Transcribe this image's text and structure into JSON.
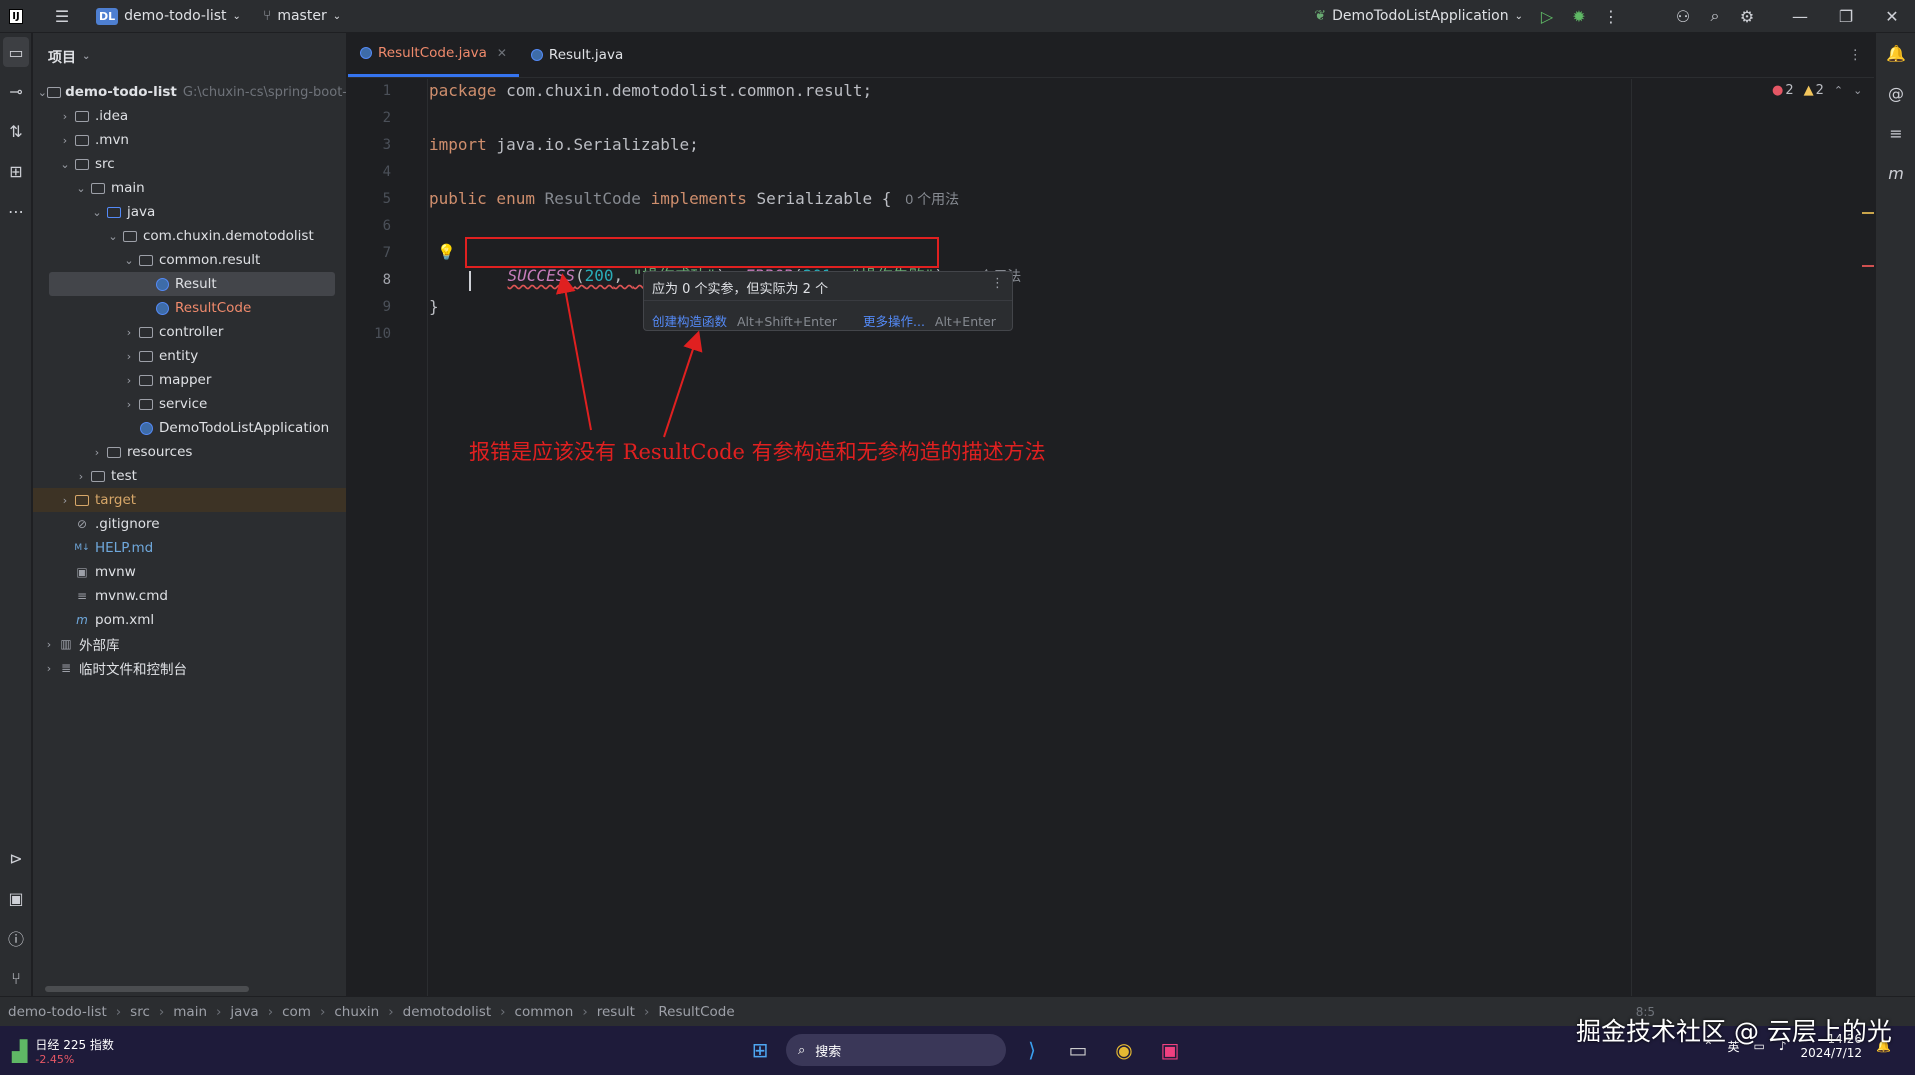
{
  "titlebar": {
    "project_badge": "DL",
    "project_name": "demo-todo-list",
    "branch": "master",
    "run_config": "DemoTodoListApplication"
  },
  "project_panel": {
    "title": "项目",
    "tree": [
      {
        "label": "demo-todo-list",
        "extra": "G:\\chuxin-cs\\spring-boot-",
        "indent": 0,
        "chev": "v",
        "icon": "folder",
        "bold": true
      },
      {
        "label": ".idea",
        "indent": 1,
        "chev": ">",
        "icon": "folder"
      },
      {
        "label": ".mvn",
        "indent": 1,
        "chev": ">",
        "icon": "folder"
      },
      {
        "label": "src",
        "indent": 1,
        "chev": "v",
        "icon": "folder"
      },
      {
        "label": "main",
        "indent": 2,
        "chev": "v",
        "icon": "folder"
      },
      {
        "label": "java",
        "indent": 3,
        "chev": "v",
        "icon": "folder-blue"
      },
      {
        "label": "com.chuxin.demotodolist",
        "indent": 4,
        "chev": "v",
        "icon": "folder"
      },
      {
        "label": "common.result",
        "indent": 5,
        "chev": "v",
        "icon": "folder"
      },
      {
        "label": "Result",
        "indent": 6,
        "chev": "",
        "icon": "class",
        "selected": true
      },
      {
        "label": "ResultCode",
        "indent": 6,
        "chev": "",
        "icon": "class",
        "color": "#f08a6c"
      },
      {
        "label": "controller",
        "indent": 5,
        "chev": ">",
        "icon": "folder"
      },
      {
        "label": "entity",
        "indent": 5,
        "chev": ">",
        "icon": "folder"
      },
      {
        "label": "mapper",
        "indent": 5,
        "chev": ">",
        "icon": "folder"
      },
      {
        "label": "service",
        "indent": 5,
        "chev": ">",
        "icon": "folder"
      },
      {
        "label": "DemoTodoListApplication",
        "indent": 5,
        "chev": "",
        "icon": "class"
      },
      {
        "label": "resources",
        "indent": 3,
        "chev": ">",
        "icon": "folder"
      },
      {
        "label": "test",
        "indent": 2,
        "chev": ">",
        "icon": "folder"
      },
      {
        "label": "target",
        "indent": 1,
        "chev": ">",
        "icon": "folder-orange",
        "target": true,
        "color": "#d7a769"
      },
      {
        "label": ".gitignore",
        "indent": 1,
        "chev": "",
        "icon": "ignore"
      },
      {
        "label": "HELP.md",
        "indent": 1,
        "chev": "",
        "icon": "md",
        "color": "#6fa8dc"
      },
      {
        "label": "mvnw",
        "indent": 1,
        "chev": "",
        "icon": "term"
      },
      {
        "label": "mvnw.cmd",
        "indent": 1,
        "chev": "",
        "icon": "text"
      },
      {
        "label": "pom.xml",
        "indent": 1,
        "chev": "",
        "icon": "maven"
      },
      {
        "label": "外部库",
        "indent": 0,
        "chev": ">",
        "icon": "lib"
      },
      {
        "label": "临时文件和控制台",
        "indent": 0,
        "chev": ">",
        "icon": "scratch"
      }
    ]
  },
  "tabs": [
    {
      "label": "ResultCode.java",
      "active": true
    },
    {
      "label": "Result.java",
      "active": false
    }
  ],
  "editor": {
    "line_numbers": [
      "1",
      "2",
      "3",
      "4",
      "5",
      "6",
      "7",
      "8",
      "9",
      "10"
    ],
    "line1": {
      "kw": "package",
      "rest": " com.chuxin.demotodolist.common.result;"
    },
    "line3": {
      "kw": "import",
      "rest": " java.io.Serializable;"
    },
    "line5": {
      "kw1": "public enum",
      "name": " ResultCode",
      "kw2": " implements",
      "rest": " Serializable {",
      "hint": "0 个用法"
    },
    "line7": {
      "c1": "SUCCESS",
      "p1": "(",
      "n1": "200",
      "s1": "\"操作成功\"",
      "c2": "ERROR",
      "n2": "201",
      "s2": "\"操作失败\"",
      "hint": "0 个用法"
    },
    "line9": "}",
    "inspections": {
      "errors": "2",
      "warnings": "2"
    }
  },
  "popup": {
    "message": "应为 0 个实参，但实际为 2 个",
    "action1": "创建构造函数",
    "action1_key": "Alt+Shift+Enter",
    "action2": "更多操作...",
    "action2_key": "Alt+Enter"
  },
  "annotation": "报错是应该没有 ResultCode 有参构造和无参构造的描述方法",
  "breadcrumb": [
    "demo-todo-list",
    "src",
    "main",
    "java",
    "com",
    "chuxin",
    "demotodolist",
    "common",
    "result",
    "ResultCode"
  ],
  "status": {
    "position": "8:5"
  },
  "taskbar": {
    "stock_name": "日经 225 指数",
    "stock_change": "-2.45%",
    "search": "搜索",
    "ime": "英",
    "time": "14:26",
    "date": "2024/7/12"
  },
  "watermark": "掘金技术社区 @ 云层上的光",
  "colors": {
    "accent": "#3574f0",
    "error": "#e02020",
    "panel": "#2b2d30",
    "editor": "#1e1f22"
  }
}
